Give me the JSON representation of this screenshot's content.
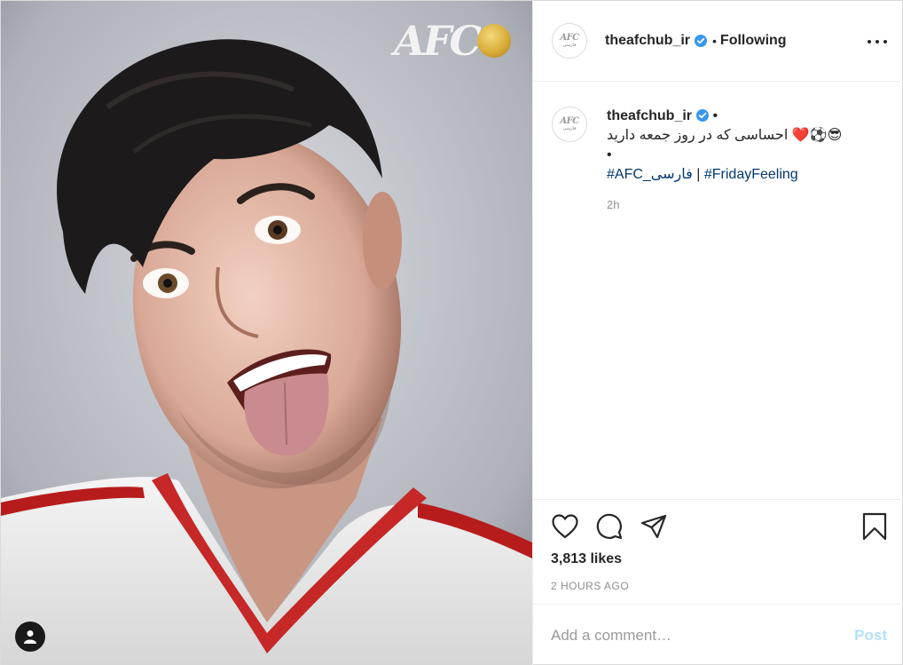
{
  "image": {
    "watermark_text": "AFC",
    "user_tag_icon": "person-icon"
  },
  "header": {
    "avatar_logo": "AFC",
    "avatar_sub": "فارسی",
    "username": "theafchub_ir",
    "separator": "•",
    "follow_status": "Following",
    "more_icon": "more-horizontal-icon"
  },
  "caption": {
    "username": "theafchub_ir",
    "after_user": "•",
    "text_emojis": "❤️⚽😎",
    "text": "احساسی که در روز جمعه دارید",
    "bullet": "•",
    "hashtag_1": "#AFC_فارسی",
    "separator": "|",
    "hashtag_2": "#FridayFeeling",
    "time": "2h"
  },
  "actions": {
    "like_icon": "heart-icon",
    "comment_icon": "comment-icon",
    "share_icon": "share-icon",
    "save_icon": "bookmark-icon",
    "likes": "3,813 likes",
    "posted_ago": "2 HOURS AGO"
  },
  "composer": {
    "placeholder": "Add a comment…",
    "post_label": "Post"
  },
  "colors": {
    "link": "#00376b",
    "verified": "#3897f0",
    "post_button_disabled": "#b2dffc",
    "muted": "#8e8e8e"
  }
}
